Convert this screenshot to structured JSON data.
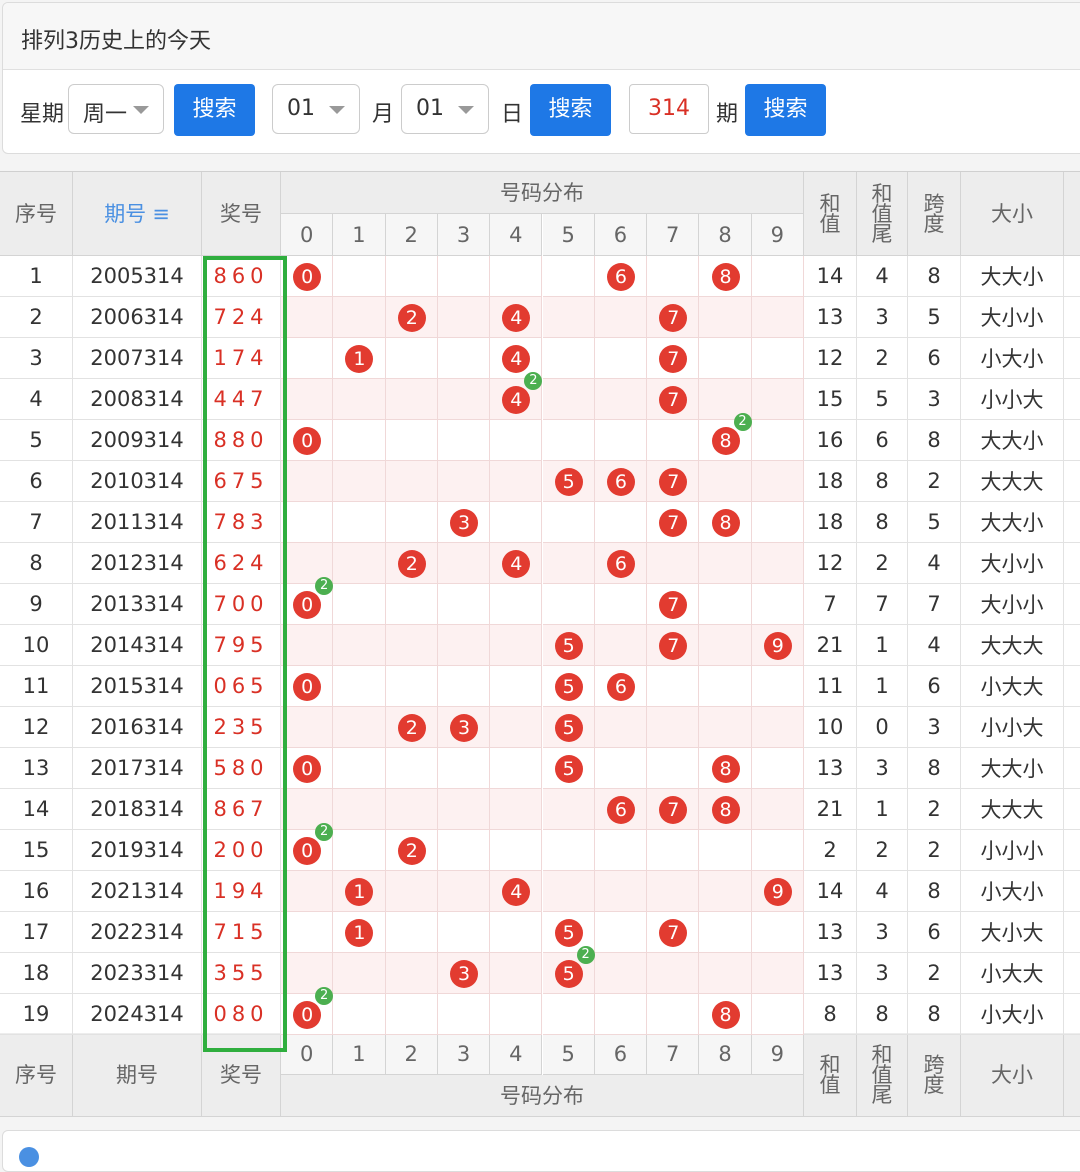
{
  "header": {
    "title": "排列3历史上的今天",
    "weekday_label": "星期",
    "weekday_value": "周一",
    "search_label": "搜索",
    "month_value": "01",
    "month_label": "月",
    "day_value": "01",
    "day_label": "日",
    "issue_value": "314",
    "issue_label": "期"
  },
  "table": {
    "col_index": "序号",
    "col_issue": "期号",
    "sort_icon": "≡",
    "col_number": "奖号",
    "col_dist": "号码分布",
    "digits": [
      "0",
      "1",
      "2",
      "3",
      "4",
      "5",
      "6",
      "7",
      "8",
      "9"
    ],
    "col_sum": "和值",
    "col_sum_tail": "和值尾",
    "col_span": "跨度",
    "col_size": "大小",
    "rows": [
      {
        "idx": "1",
        "issue": "2005314",
        "num": "860",
        "sum": "14",
        "tail": "4",
        "span": "8",
        "size": "大大小"
      },
      {
        "idx": "2",
        "issue": "2006314",
        "num": "724",
        "sum": "13",
        "tail": "3",
        "span": "5",
        "size": "大小小"
      },
      {
        "idx": "3",
        "issue": "2007314",
        "num": "174",
        "sum": "12",
        "tail": "2",
        "span": "6",
        "size": "小大小"
      },
      {
        "idx": "4",
        "issue": "2008314",
        "num": "447",
        "sum": "15",
        "tail": "5",
        "span": "3",
        "size": "小小大"
      },
      {
        "idx": "5",
        "issue": "2009314",
        "num": "880",
        "sum": "16",
        "tail": "6",
        "span": "8",
        "size": "大大小"
      },
      {
        "idx": "6",
        "issue": "2010314",
        "num": "675",
        "sum": "18",
        "tail": "8",
        "span": "2",
        "size": "大大大"
      },
      {
        "idx": "7",
        "issue": "2011314",
        "num": "783",
        "sum": "18",
        "tail": "8",
        "span": "5",
        "size": "大大小"
      },
      {
        "idx": "8",
        "issue": "2012314",
        "num": "624",
        "sum": "12",
        "tail": "2",
        "span": "4",
        "size": "大小小"
      },
      {
        "idx": "9",
        "issue": "2013314",
        "num": "700",
        "sum": "7",
        "tail": "7",
        "span": "7",
        "size": "大小小"
      },
      {
        "idx": "10",
        "issue": "2014314",
        "num": "795",
        "sum": "21",
        "tail": "1",
        "span": "4",
        "size": "大大大"
      },
      {
        "idx": "11",
        "issue": "2015314",
        "num": "065",
        "sum": "11",
        "tail": "1",
        "span": "6",
        "size": "小大大"
      },
      {
        "idx": "12",
        "issue": "2016314",
        "num": "235",
        "sum": "10",
        "tail": "0",
        "span": "3",
        "size": "小小大"
      },
      {
        "idx": "13",
        "issue": "2017314",
        "num": "580",
        "sum": "13",
        "tail": "3",
        "span": "8",
        "size": "大大小"
      },
      {
        "idx": "14",
        "issue": "2018314",
        "num": "867",
        "sum": "21",
        "tail": "1",
        "span": "2",
        "size": "大大大"
      },
      {
        "idx": "15",
        "issue": "2019314",
        "num": "200",
        "sum": "2",
        "tail": "2",
        "span": "2",
        "size": "小小小"
      },
      {
        "idx": "16",
        "issue": "2021314",
        "num": "194",
        "sum": "14",
        "tail": "4",
        "span": "8",
        "size": "小大小"
      },
      {
        "idx": "17",
        "issue": "2022314",
        "num": "715",
        "sum": "13",
        "tail": "3",
        "span": "6",
        "size": "大小大"
      },
      {
        "idx": "18",
        "issue": "2023314",
        "num": "355",
        "sum": "13",
        "tail": "3",
        "span": "2",
        "size": "小大大"
      },
      {
        "idx": "19",
        "issue": "2024314",
        "num": "080",
        "sum": "8",
        "tail": "8",
        "span": "8",
        "size": "小大小"
      }
    ]
  },
  "colors": {
    "accent": "#1e78e6",
    "ball": "#e23b30",
    "repeat": "#4caf50",
    "highlight": "#2fae3e"
  }
}
